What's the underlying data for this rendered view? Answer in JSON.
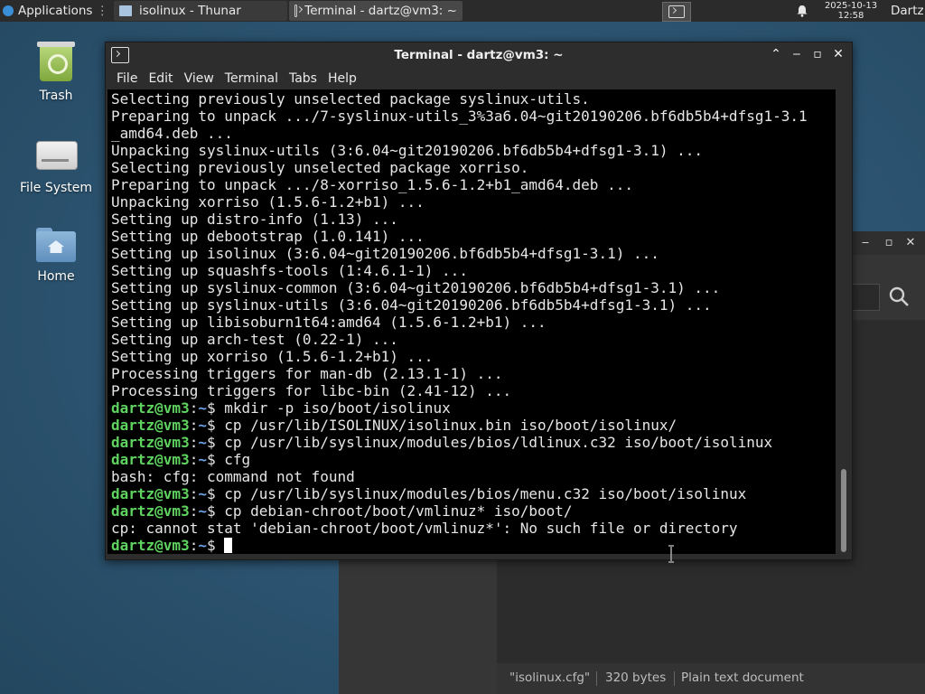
{
  "panel": {
    "applications_label": "Applications",
    "tasks": [
      {
        "label": "isolinux - Thunar"
      },
      {
        "label": "Terminal - dartz@vm3: ~"
      }
    ],
    "clock_date": "2025-10-13",
    "clock_time": "12:58",
    "user": "Dartz"
  },
  "desktop": {
    "icons": [
      {
        "label": "Trash"
      },
      {
        "label": "File System"
      },
      {
        "label": "Home"
      }
    ]
  },
  "thunar": {
    "status_name": "\"isolinux.cfg\"",
    "status_size": "320 bytes",
    "status_type": "Plain text document"
  },
  "terminal": {
    "title": "Terminal - dartz@vm3: ~",
    "menu": [
      "File",
      "Edit",
      "View",
      "Terminal",
      "Tabs",
      "Help"
    ],
    "output_lines": [
      "Selecting previously unselected package syslinux-utils.",
      "Preparing to unpack .../7-syslinux-utils_3%3a6.04~git20190206.bf6db5b4+dfsg1-3.1",
      "_amd64.deb ...",
      "Unpacking syslinux-utils (3:6.04~git20190206.bf6db5b4+dfsg1-3.1) ...",
      "Selecting previously unselected package xorriso.",
      "Preparing to unpack .../8-xorriso_1.5.6-1.2+b1_amd64.deb ...",
      "Unpacking xorriso (1.5.6-1.2+b1) ...",
      "Setting up distro-info (1.13) ...",
      "Setting up debootstrap (1.0.141) ...",
      "Setting up isolinux (3:6.04~git20190206.bf6db5b4+dfsg1-3.1) ...",
      "Setting up squashfs-tools (1:4.6.1-1) ...",
      "Setting up syslinux-common (3:6.04~git20190206.bf6db5b4+dfsg1-3.1) ...",
      "Setting up syslinux-utils (3:6.04~git20190206.bf6db5b4+dfsg1-3.1) ...",
      "Setting up libisoburn1t64:amd64 (1.5.6-1.2+b1) ...",
      "Setting up arch-test (0.22-1) ...",
      "Setting up xorriso (1.5.6-1.2+b1) ...",
      "Processing triggers for man-db (2.13.1-1) ...",
      "Processing triggers for libc-bin (2.41-12) ..."
    ],
    "prompt_user": "dartz@vm3",
    "prompt_path": "~",
    "session": [
      {
        "cmd": "mkdir -p iso/boot/isolinux"
      },
      {
        "cmd": "cp /usr/lib/ISOLINUX/isolinux.bin iso/boot/isolinux/"
      },
      {
        "cmd": "cp /usr/lib/syslinux/modules/bios/ldlinux.c32 iso/boot/isolinux"
      },
      {
        "cmd": "cfg",
        "out": "bash: cfg: command not found"
      },
      {
        "cmd": "cp /usr/lib/syslinux/modules/bios/menu.c32 iso/boot/isolinux"
      },
      {
        "cmd": "cp debian-chroot/boot/vmlinuz* iso/boot/",
        "out": "cp: cannot stat 'debian-chroot/boot/vmlinuz*': No such file or directory"
      },
      {
        "cmd": ""
      }
    ]
  }
}
